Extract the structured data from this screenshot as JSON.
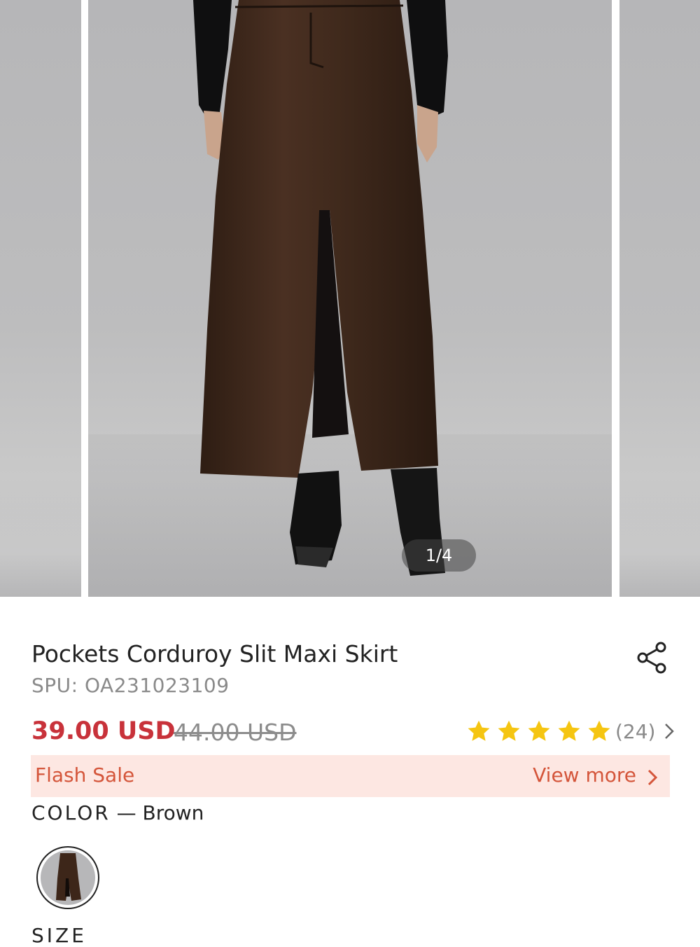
{
  "gallery": {
    "counter": "1/4",
    "main_image_alt": "brown corduroy maxi skirt with front slit worn with black boots"
  },
  "product": {
    "title": "Pockets Corduroy Slit Maxi Skirt",
    "spu": "SPU: OA231023109",
    "price": "39.00 USD",
    "original_price": "44.00 USD",
    "rating": {
      "stars": 5,
      "count": "(24)"
    }
  },
  "flash_sale": {
    "label": "Flash Sale",
    "link": "View more"
  },
  "color": {
    "key": "COLOR",
    "separator": "—",
    "value": "Brown",
    "swatch_color": "#3d2619"
  },
  "size": {
    "label": "SIZE"
  },
  "icons": {
    "share": "share-icon",
    "star": "star-icon",
    "chevron": "chevron-right-icon"
  },
  "colors": {
    "price_red": "#c8323a",
    "flash_bg": "#fde7e2",
    "flash_text": "#d4553a",
    "star_yellow": "#f5c511"
  }
}
